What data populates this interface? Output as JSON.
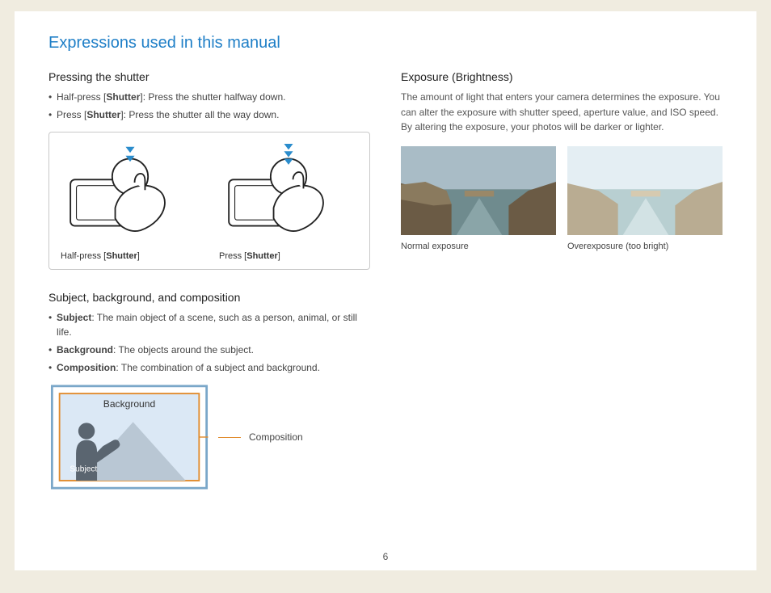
{
  "title": "Expressions used in this manual",
  "page_number": "6",
  "left": {
    "shutter": {
      "heading": "Pressing the shutter",
      "bullets": [
        {
          "pre": "Half-press [",
          "bold": "Shutter",
          "post": "]: Press the shutter halfway down."
        },
        {
          "pre": "Press [",
          "bold": "Shutter",
          "post": "]: Press the shutter all the way down."
        }
      ],
      "caption1_pre": "Half-press [",
      "caption1_bold": "Shutter",
      "caption1_post": "]",
      "caption2_pre": "Press [",
      "caption2_bold": "Shutter",
      "caption2_post": "]"
    },
    "sbc": {
      "heading": "Subject, background, and composition",
      "bullets": [
        {
          "bold": "Subject",
          "post": ": The main object of a scene, such as a person, animal, or still life."
        },
        {
          "bold": "Background",
          "post": ": The objects around the subject."
        },
        {
          "bold": "Composition",
          "post": ": The combination of a subject and background."
        }
      ],
      "label_background": "Background",
      "label_subject": "Subject",
      "label_composition": "Composition"
    }
  },
  "right": {
    "exposure": {
      "heading": "Exposure (Brightness)",
      "paragraph": "The amount of light that enters your camera determines the exposure. You can alter the exposure with shutter speed, aperture value, and ISO speed. By altering the exposure, your photos will be darker or lighter.",
      "caption_normal": "Normal exposure",
      "caption_over": "Overexposure (too bright)"
    }
  }
}
